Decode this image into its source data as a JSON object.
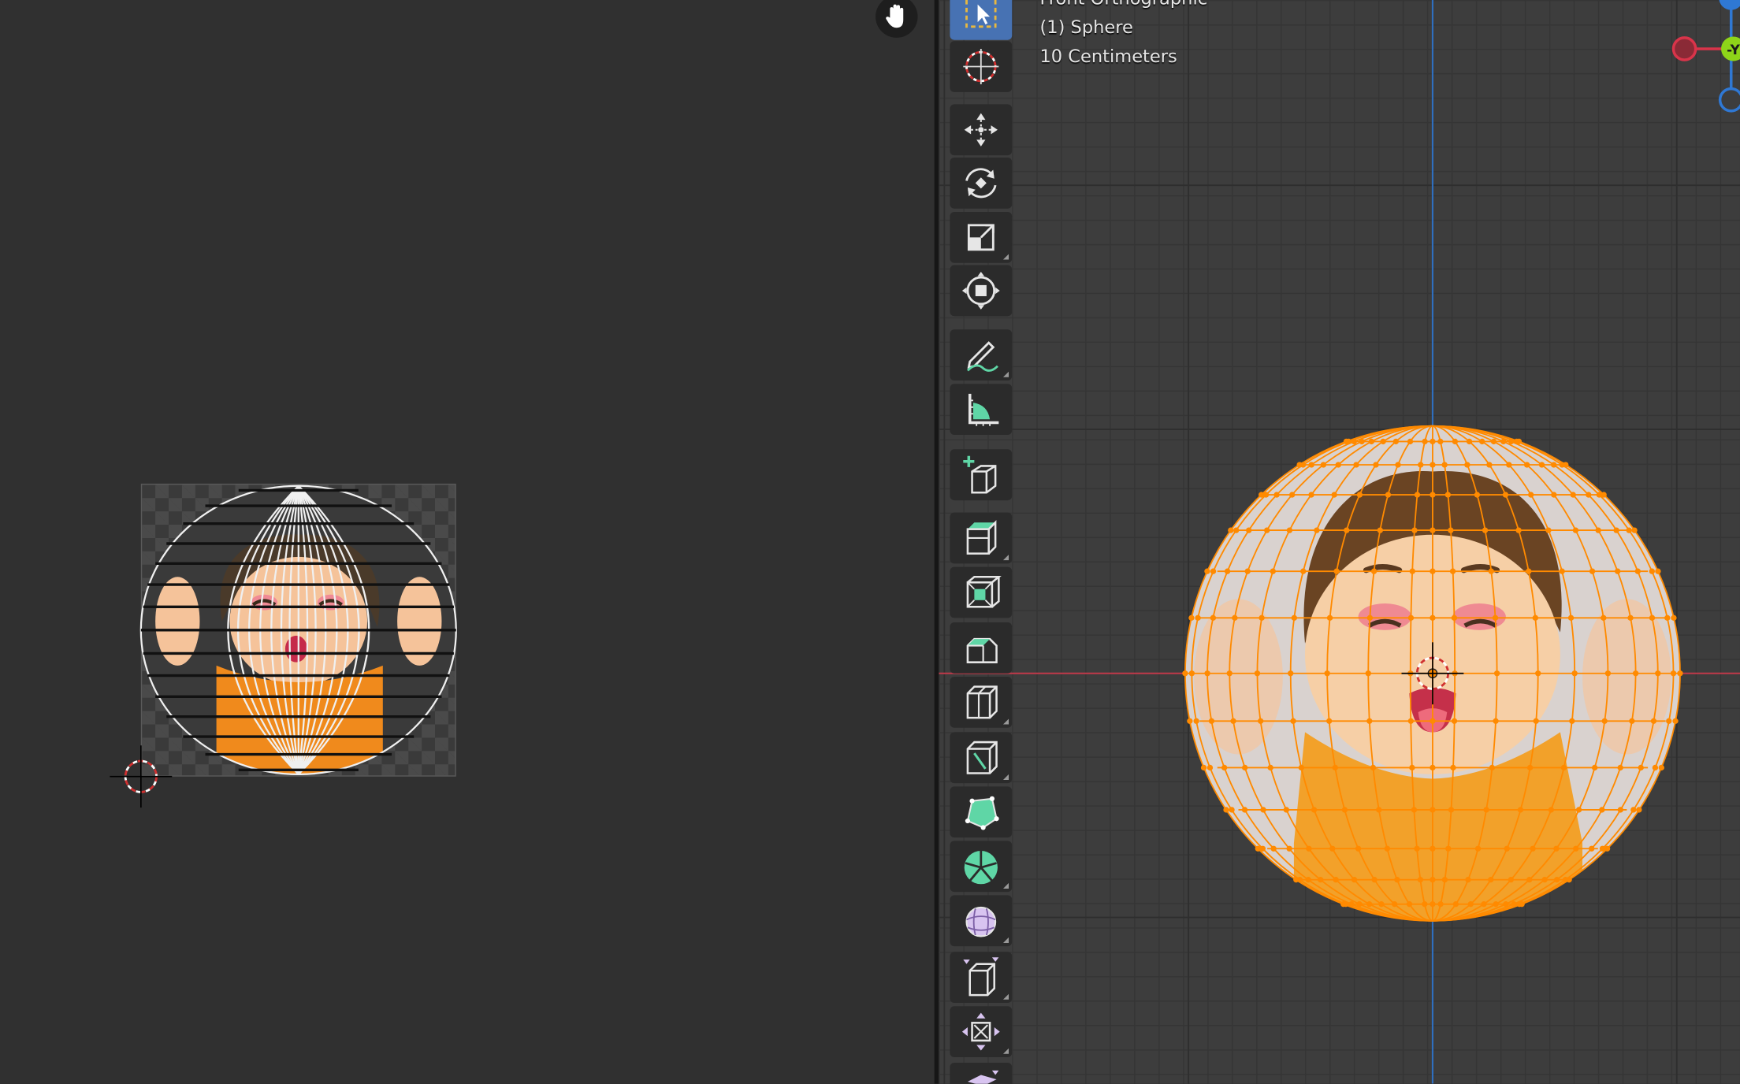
{
  "uv_editor": {
    "tools": {
      "hand": {
        "icon": "hand-icon"
      }
    },
    "colors": {
      "wire": "#ffffff",
      "vertex": "#000000",
      "cursor": "#d03030"
    }
  },
  "viewport": {
    "info": {
      "view_name": "Front Orthographic",
      "object": "(1) Sphere",
      "scale": "10 Centimeters"
    },
    "colors": {
      "grid": "#353535",
      "x_axis": "#c0394a",
      "z_axis": "#2f6fbf",
      "selection": "#ff8a00",
      "gizmo_x": "#d9344a",
      "gizmo_y": "#8ed419",
      "gizmo_z": "#2f78d4"
    },
    "gizmo": {
      "y_label": "-Y"
    },
    "toolbar": [
      {
        "name": "select-box-tool",
        "icon": "select-box-icon",
        "active": true
      },
      {
        "name": "cursor-tool",
        "icon": "cursor-icon"
      },
      {
        "name": "move-tool",
        "icon": "move-icon"
      },
      {
        "name": "rotate-tool",
        "icon": "rotate-icon"
      },
      {
        "name": "scale-tool",
        "icon": "scale-icon"
      },
      {
        "name": "transform-tool",
        "icon": "transform-icon"
      },
      {
        "name": "annotate-tool",
        "icon": "annotate-icon"
      },
      {
        "name": "measure-tool",
        "icon": "measure-icon"
      },
      {
        "name": "add-cube-tool",
        "icon": "add-cube-icon"
      },
      {
        "name": "extrude-region-tool",
        "icon": "extrude-icon"
      },
      {
        "name": "inset-faces-tool",
        "icon": "inset-icon"
      },
      {
        "name": "bevel-tool",
        "icon": "bevel-icon"
      },
      {
        "name": "loop-cut-tool",
        "icon": "loop-cut-icon"
      },
      {
        "name": "knife-tool",
        "icon": "knife-icon"
      },
      {
        "name": "poly-build-tool",
        "icon": "poly-build-icon"
      },
      {
        "name": "spin-tool",
        "icon": "spin-icon"
      },
      {
        "name": "smooth-tool",
        "icon": "smooth-icon"
      },
      {
        "name": "edge-slide-tool",
        "icon": "edge-slide-icon"
      },
      {
        "name": "shrink-fatten-tool",
        "icon": "shrink-fatten-icon"
      },
      {
        "name": "shear-tool",
        "icon": "shear-icon"
      }
    ]
  }
}
